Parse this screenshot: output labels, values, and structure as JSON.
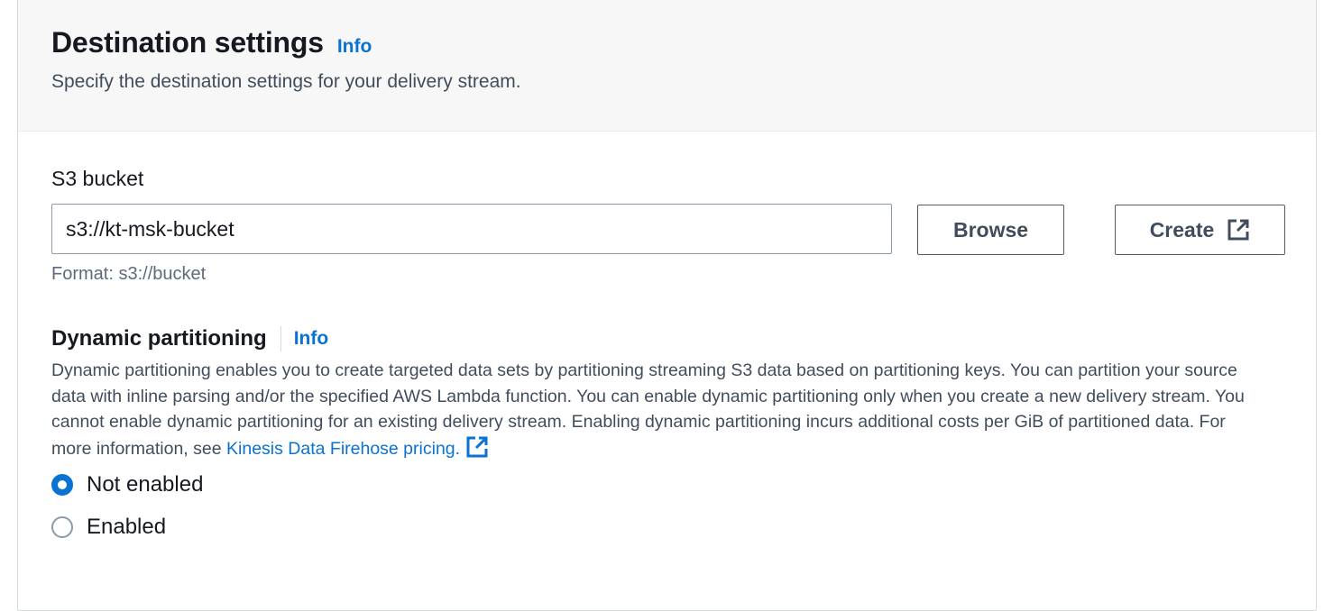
{
  "header": {
    "title": "Destination settings",
    "info_label": "Info",
    "description": "Specify the destination settings for your delivery stream."
  },
  "s3": {
    "label": "S3 bucket",
    "value": "s3://kt-msk-bucket",
    "browse_label": "Browse",
    "create_label": "Create",
    "create_icon": "external-link-icon",
    "format_hint": "Format: s3://bucket"
  },
  "dynamic_partitioning": {
    "title": "Dynamic partitioning",
    "info_label": "Info",
    "description": "Dynamic partitioning enables you to create targeted data sets by partitioning streaming S3 data based on partitioning keys. You can partition your source data with inline parsing and/or the specified AWS Lambda function. You can enable dynamic partitioning only when you create a new delivery stream. You cannot enable dynamic partitioning for an existing delivery stream. Enabling dynamic partitioning incurs additional costs per GiB of partitioned data. For more information, see",
    "link_label": "Kinesis Data Firehose pricing.",
    "link_icon": "external-link-icon",
    "options": [
      {
        "label": "Not enabled",
        "selected": true
      },
      {
        "label": "Enabled",
        "selected": false
      }
    ]
  },
  "colors": {
    "link": "#0972d3",
    "header_bg": "#f7f7f7",
    "text": "#16191f",
    "secondary_text": "#414d5c"
  }
}
